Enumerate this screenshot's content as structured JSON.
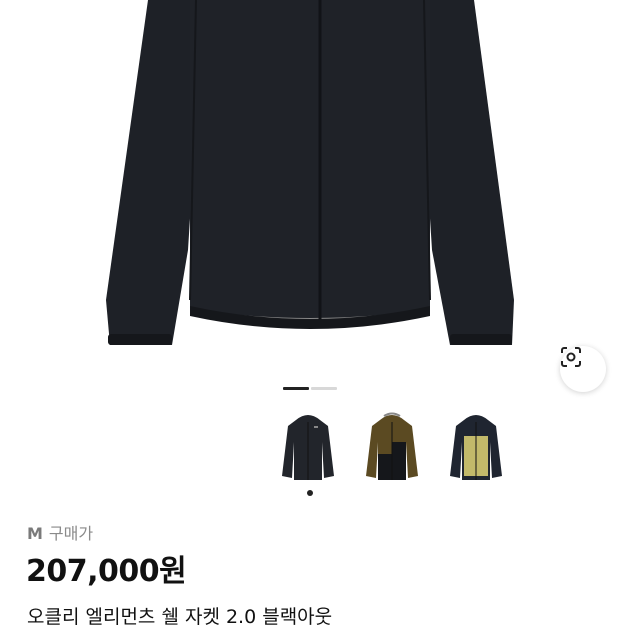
{
  "gallery": {
    "slide_count": 2,
    "active_slide": 1,
    "lens_icon": "visual-search-icon",
    "thumbnails": [
      {
        "name": "black",
        "colors": {
          "body": "#22252b",
          "hood": "#22252b",
          "trim": "#2a2d33"
        }
      },
      {
        "name": "brown-black",
        "colors": {
          "body": "#5b4a22",
          "hood": "#5b4a22",
          "trim": "#15171b"
        }
      },
      {
        "name": "olive-navy",
        "colors": {
          "body": "#c2b96a",
          "hood": "#1f2530",
          "trim": "#1f2530"
        }
      }
    ],
    "selected_thumbnail": 0
  },
  "product": {
    "size": "M",
    "price_label": "구매가",
    "price": "207,000원",
    "name": "오클리 엘리먼츠 쉘 자켓 2.0 블랙아웃"
  },
  "colors": {
    "jacket": "#1e2127",
    "jacket_shadow": "#15171b",
    "lining": "#8a8a8a",
    "text_muted": "#8a8a8a"
  }
}
